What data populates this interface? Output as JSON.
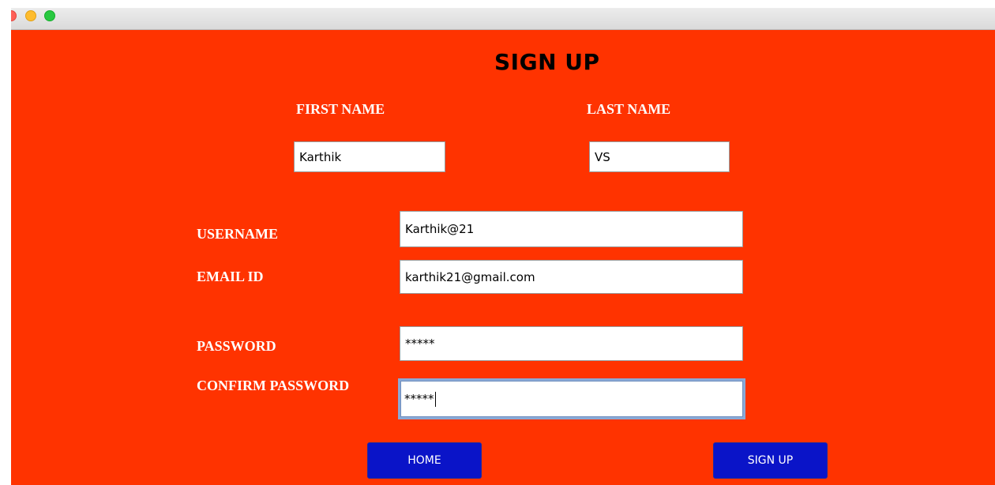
{
  "window": {
    "traffic_lights": [
      "close",
      "minimize",
      "zoom"
    ]
  },
  "form": {
    "title": "SIGN UP",
    "first_name": {
      "label": "FIRST NAME",
      "value": "Karthik"
    },
    "last_name": {
      "label": "LAST NAME",
      "value": "VS"
    },
    "username": {
      "label": "USERNAME",
      "value": "Karthik@21"
    },
    "email": {
      "label": "EMAIL ID",
      "value": "karthik21@gmail.com"
    },
    "password": {
      "label": "PASSWORD",
      "value": "*****"
    },
    "confirm_password": {
      "label": "CONFIRM PASSWORD",
      "value": "*****"
    }
  },
  "buttons": {
    "home": "HOME",
    "sign_up": "SIGN UP"
  },
  "colors": {
    "background": "#ff3300",
    "button": "#0a14c8",
    "label_text": "#ffffff",
    "title_text": "#000000"
  }
}
